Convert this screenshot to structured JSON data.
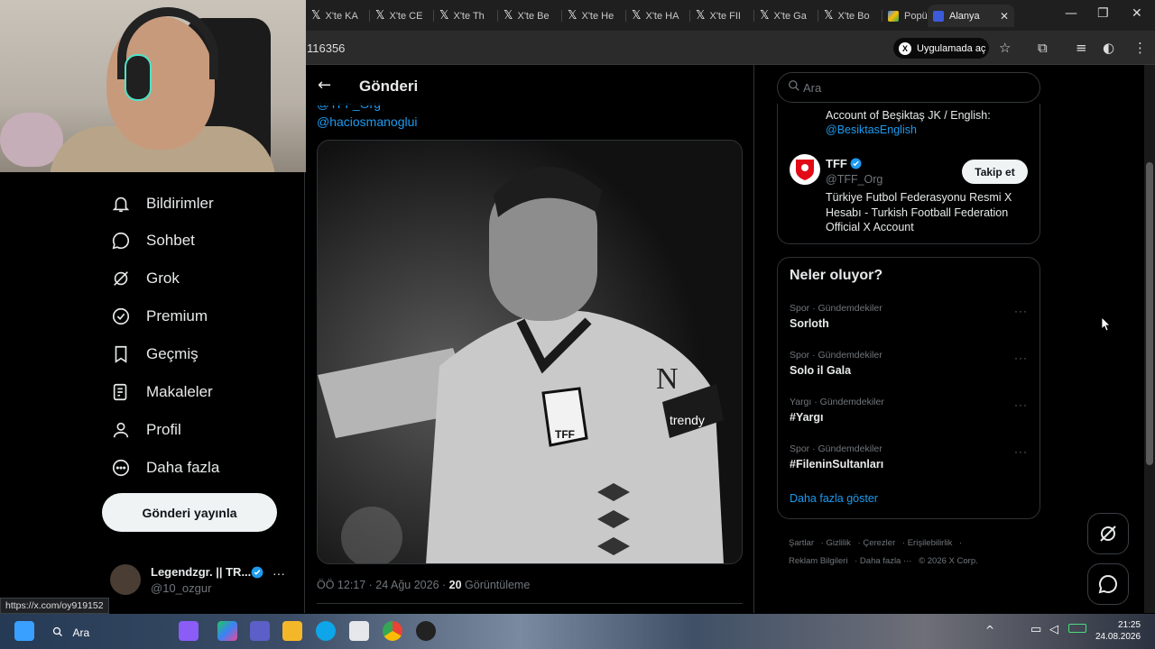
{
  "browser": {
    "tabs": [
      {
        "label": "X'te KA",
        "icon": "x-logo"
      },
      {
        "label": "X'te CE",
        "icon": "x-logo"
      },
      {
        "label": "X'te Th",
        "icon": "x-logo"
      },
      {
        "label": "X'te Be",
        "icon": "x-logo"
      },
      {
        "label": "X'te He",
        "icon": "x-logo"
      },
      {
        "label": "X'te HA",
        "icon": "x-logo"
      },
      {
        "label": "X'te FII",
        "icon": "x-logo"
      },
      {
        "label": "X'te Ga",
        "icon": "x-logo"
      },
      {
        "label": "X'te Bo",
        "icon": "x-logo"
      },
      {
        "label": "Popüle",
        "icon": "colorful-icon"
      },
      {
        "label": "Alanyа",
        "icon": "blue-square-icon"
      }
    ],
    "url_fragment": "116356",
    "open_in_app": "Uygulamada aç",
    "status_url": "https://x.com/oy919152"
  },
  "nav": {
    "items": [
      {
        "label": "Bildirimler",
        "icon": "bell-icon"
      },
      {
        "label": "Sohbet",
        "icon": "chat-icon"
      },
      {
        "label": "Grok",
        "icon": "grok-icon"
      },
      {
        "label": "Premium",
        "icon": "verified-icon"
      },
      {
        "label": "Geçmiş",
        "icon": "bookmark-icon"
      },
      {
        "label": "Makaleler",
        "icon": "article-icon"
      },
      {
        "label": "Profil",
        "icon": "person-icon"
      },
      {
        "label": "Daha fazla",
        "icon": "more-circle-icon"
      }
    ],
    "post_button": "Gönderi yayınla",
    "account": {
      "name": "Legendzgr. || TR...",
      "handle": "@10_ozgur"
    }
  },
  "post": {
    "header_title": "Gönderi",
    "mention_partial": "@TFF_Org",
    "mention": "@haciosmanoglui",
    "time": "ÖÖ 12:17 · 24 Ağu 2026 ·",
    "views_count": "20",
    "views_label": "Görüntüleme"
  },
  "sidebar": {
    "search_placeholder": "Ara",
    "who_to_follow_partial": "Account of Beşiktaş JK / English:",
    "who_to_follow_partial_link": "@BesiktasEnglish",
    "tff": {
      "name": "TFF",
      "handle": "@TFF_Org",
      "bio": "Türkiye Futbol Federasyonu Resmi X Hesabı - Turkish Football Federation Official X Account",
      "follow_label": "Takip et"
    },
    "trends_title": "Neler oluyor?",
    "trends": [
      {
        "category": "Spor · Gündemdekiler",
        "name": "Sorloth"
      },
      {
        "category": "Spor · Gündemdekiler",
        "name": "Solo il Gala"
      },
      {
        "category": "Yargı · Gündemdekiler",
        "name": "#Yargı"
      },
      {
        "category": "Spor · Gündemdekiler",
        "name": "#FileninSultanları"
      }
    ],
    "show_more": "Daha fazla göster",
    "footer": {
      "row1": [
        "Şartlar",
        "Gizlilik",
        "Çerezler",
        "Erişilebilirlik"
      ],
      "row2": [
        "Reklam Bilgileri",
        "Daha fazla ···",
        "© 2026 X Corp."
      ]
    }
  },
  "taskbar": {
    "search_label": "Ara",
    "time": "21:25",
    "date": "24.08.2026"
  },
  "colors": {
    "accent": "#1d9bf0",
    "background": "#000000",
    "border": "#2f3336",
    "muted": "#71767b"
  }
}
